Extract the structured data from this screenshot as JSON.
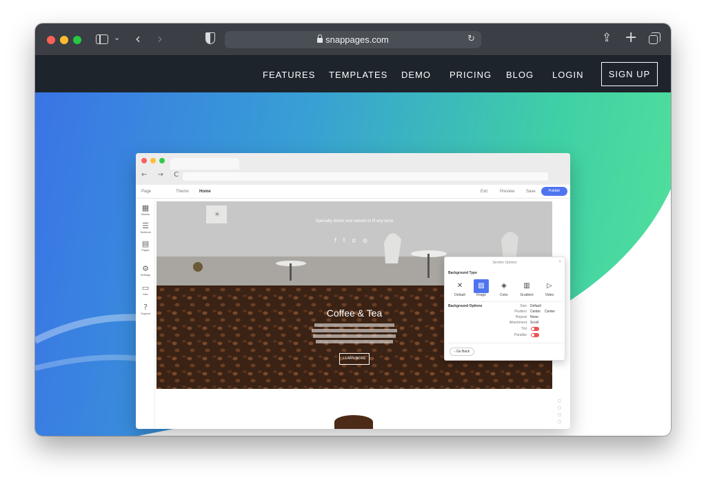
{
  "browser": {
    "url": "snappages.com"
  },
  "site_nav": {
    "links": [
      "FEATURES",
      "TEMPLATES",
      "DEMO",
      "PRICING",
      "BLOG",
      "LOGIN"
    ],
    "signup": "SIGN UP"
  },
  "editor": {
    "topbar": {
      "page_tab": "Page",
      "theme_tab": "Theme",
      "current_page": "Home",
      "exit": "Exit",
      "preview": "Preview",
      "save": "Save",
      "publish": "Publish"
    },
    "tools": [
      "Blocks",
      "Sections",
      "Pages",
      "Settings",
      "Size",
      "Support"
    ],
    "cafe_tagline": "Specialty drinks and sweets to fit any taste",
    "section_title": "Coffee & Tea",
    "learn_more": "LEARN MORE",
    "section_options": {
      "title": "Section Options",
      "background_type_heading": "Background Type",
      "types": [
        "Default",
        "Image",
        "Color",
        "Gradient",
        "Video"
      ],
      "selected_type": "Image",
      "background_options_heading": "Background Options",
      "options": [
        {
          "label": "Size",
          "value": "Default"
        },
        {
          "label": "Position",
          "value": "Center",
          "value2": "Center"
        },
        {
          "label": "Repeat",
          "value": "None"
        },
        {
          "label": "Attachment",
          "value": "Scroll"
        },
        {
          "label": "Tint",
          "value": ""
        },
        {
          "label": "Parallax",
          "value": ""
        }
      ],
      "go_back": "Go Back"
    }
  },
  "colors": {
    "nav_bg": "#1d242c",
    "publish_blue": "#4f74f0",
    "toggle_red": "#e95454"
  }
}
